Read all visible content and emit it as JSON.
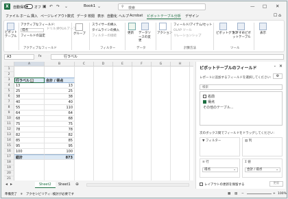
{
  "titlebar": {
    "autosave": "自動保存",
    "toggle": "オフ",
    "book": "Book1",
    "search": "検索",
    "minimize": "—",
    "maximize": "□",
    "close": "✕"
  },
  "tabs": [
    "ファイル",
    "ホーム",
    "挿入",
    "ページレイアウト",
    "数式",
    "データ",
    "校閲",
    "表示",
    "自動化",
    "ヘルプ",
    "Acrobat",
    "ピボットテーブル分析",
    "デザイン"
  ],
  "ribbon": {
    "pivot_btn": "ピボットテーブル",
    "active_field_label": "アクティブなフィールド:",
    "active_field_value": "得点",
    "drilldown": "ドリルダウン",
    "drillup": "ドリルアップ",
    "field_settings": "フィールドの設定",
    "active_field_group": "アクティブなフィールド",
    "group_btn": "グループ",
    "slicer": "スライサーの挿入",
    "timeline": "タイムラインの挿入",
    "filter_conn": "フィルターの接続",
    "filter_group": "フィルター",
    "refresh": "更新",
    "change_source": "データソースの変更",
    "data_group": "データ",
    "actions": "アクション",
    "fields_items": "フィールド/アイテム/セット",
    "olap": "OLAP ツール",
    "relations": "リレーションシップ",
    "calc_group": "計算方法",
    "pivotchart": "ピボットグラフ",
    "recommended": "おすすめピボットテーブル",
    "tools_group": "ツール",
    "show": "表示"
  },
  "formula": {
    "namebox": "A3",
    "fx": "fx",
    "value": "行ラベル"
  },
  "grid": {
    "columns": [
      "A",
      "B",
      "C",
      "D",
      "E",
      "F",
      "G",
      "H",
      "I",
      "J",
      "K",
      "L"
    ],
    "header_row": {
      "row": "3",
      "label": "行ラベル",
      "value": "合計 / 得点"
    },
    "rows": [
      {
        "row": "4",
        "label": "13",
        "value": "13"
      },
      {
        "row": "5",
        "label": "25",
        "value": "25"
      },
      {
        "row": "6",
        "label": "38",
        "value": "38"
      },
      {
        "row": "7",
        "label": "40",
        "value": "40"
      },
      {
        "row": "8",
        "label": "55",
        "value": "110"
      },
      {
        "row": "9",
        "label": "64",
        "value": "64"
      },
      {
        "row": "10",
        "label": "68",
        "value": "68"
      },
      {
        "row": "11",
        "label": "75",
        "value": "75"
      },
      {
        "row": "12",
        "label": "78",
        "value": "78"
      },
      {
        "row": "13",
        "label": "82",
        "value": "82"
      },
      {
        "row": "14",
        "label": "85",
        "value": "85"
      },
      {
        "row": "15",
        "label": "95",
        "value": "95"
      },
      {
        "row": "16",
        "label": "100",
        "value": "100"
      }
    ],
    "total_row": {
      "row": "17",
      "label": "総計",
      "value": "873"
    },
    "empty_rows": [
      "1",
      "2",
      "18",
      "19",
      "20",
      "21"
    ]
  },
  "sheet_tabs": [
    "Sheet2",
    "Sheet1"
  ],
  "pane": {
    "title": "ピボットテーブルのフィールド",
    "subtitle": "レポートに追加するフィールドを選択してください:",
    "search": "検索",
    "fields": [
      {
        "name": "名前",
        "checked": false
      },
      {
        "name": "得点",
        "checked": true
      }
    ],
    "more": "その他のテーブル...",
    "drag_hint": "次のボックス間でフィールドをドラッグしてください:",
    "filter": "フィルター",
    "columns": "列",
    "rows": "行",
    "values": "値",
    "rows_chip": "得点",
    "values_chip": "合計 / 得点",
    "defer": "レイアウトの更新を保留する",
    "update": "更新"
  },
  "status": {
    "ready": "準備完了",
    "access": "アクセシビリティ: 検討が必要です",
    "zoom": "100%"
  }
}
